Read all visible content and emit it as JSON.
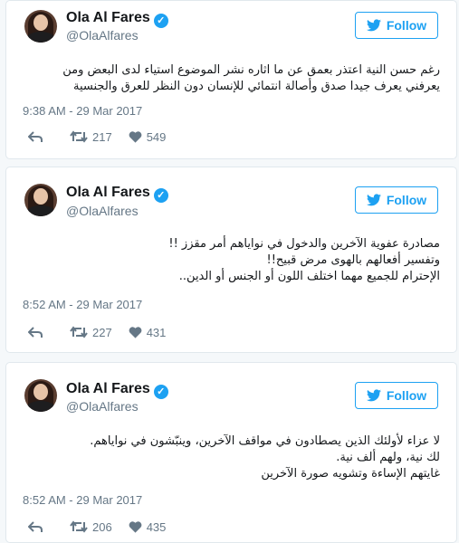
{
  "tweets": [
    {
      "author": {
        "name": "Ola Al Fares",
        "handle": "@OlaAlfares"
      },
      "follow_label": "Follow",
      "lines": [
        "رغم حسن النية اعتذر بعمق عن ما اثاره نشر الموضوع استياء لدى البعض ومن",
        "يعرفني يعرف جيدا صدق وأصالة انتمائي للإنسان دون النظر للعرق والجنسية"
      ],
      "timestamp": "9:38 AM - 29 Mar 2017",
      "retweets": "217",
      "likes": "549"
    },
    {
      "author": {
        "name": "Ola Al Fares",
        "handle": "@OlaAlfares"
      },
      "follow_label": "Follow",
      "lines": [
        "مصادرة عفوية الآخرين والدخول في نواياهم أمر مقزز !!",
        "وتفسير أفعالهم بالهوى مرض قبيح!!",
        "الإحترام للجميع مهما اختلف اللون أو الجنس أو الدين.."
      ],
      "timestamp": "8:52 AM - 29 Mar 2017",
      "retweets": "227",
      "likes": "431"
    },
    {
      "author": {
        "name": "Ola Al Fares",
        "handle": "@OlaAlfares"
      },
      "follow_label": "Follow",
      "lines": [
        "لا عزاء لأولئك الذين يصطادون في مواقف الآخرين، وينبّشون في نواياهم.",
        "لك نية، ولهم ألف نية.",
        "غايتهم الإساءة وتشويه صورة الآخرين"
      ],
      "timestamp": "8:52 AM - 29 Mar 2017",
      "retweets": "206",
      "likes": "435"
    }
  ],
  "colors": {
    "accent": "#1da1f2",
    "muted": "#657786",
    "border": "#e1e8ed"
  },
  "icons": [
    "verified-icon",
    "twitter-bird-icon",
    "reply-icon",
    "retweet-icon",
    "heart-icon"
  ]
}
